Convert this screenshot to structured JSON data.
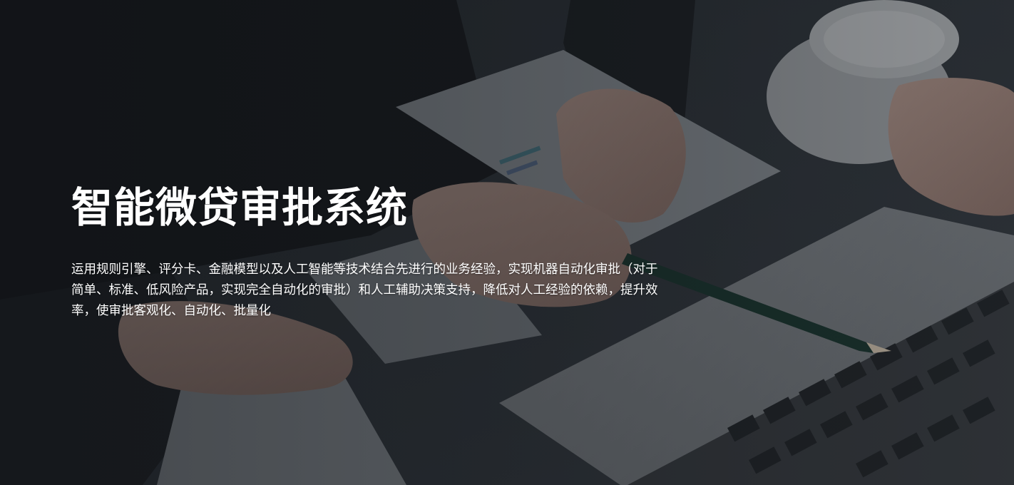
{
  "hero": {
    "title": "智能微贷审批系统",
    "description": "运用规则引擎、评分卡、金融模型以及人工智能等技术结合先进行的业务经验，实现机器自动化审批（对于简单、标准、低风险产品，实现完全自动化的审批）和人工辅助决策支持，降低对人工经验的依赖，提升效率，使审批客观化、自动化、批量化"
  },
  "colors": {
    "text": "#ffffff",
    "background": "#2a2f35"
  },
  "background_image": {
    "icon": "business-meeting-photo"
  }
}
